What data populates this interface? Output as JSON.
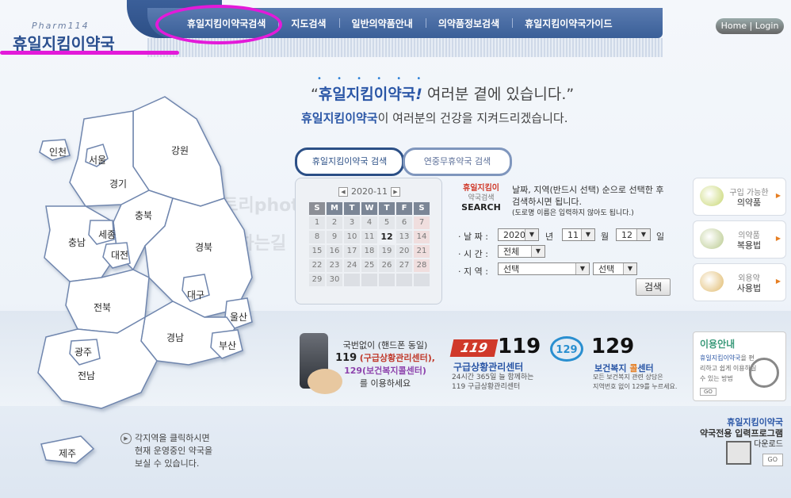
{
  "logo": {
    "sub": "Pharm114",
    "main": "휴일지킴이약국"
  },
  "nav": [
    "휴일지킴이약국검색",
    "지도검색",
    "일반의약품안내",
    "의약품정보검색",
    "휴일지킴이약국가이드"
  ],
  "home_login": "Home | Login",
  "headline": {
    "brand": "휴일지킴이약국",
    "mark": "!",
    "rest": " 여러분 곁에 있습니다.",
    "open_q": "“",
    "close_q": "”"
  },
  "subline": {
    "brand": "휴일지킴이약국",
    "rest": "이 여러분의 건강을 지켜드리겠습니다."
  },
  "watermark": {
    "line1": "스토리photo",
    "line2": "추월하는길"
  },
  "map": {
    "regions": [
      "인천",
      "서울",
      "경기",
      "강원",
      "충북",
      "세종",
      "대전",
      "충남",
      "경북",
      "대구",
      "전북",
      "울산",
      "경남",
      "부산",
      "광주",
      "전남",
      "제주"
    ],
    "hint": [
      "각지역을 클릭하시면",
      "현재 운영중인 약국을",
      "보실 수 있습니다."
    ]
  },
  "tabs": {
    "active": "휴일지킴이약국 검색",
    "inactive": "연중무휴약국 검색"
  },
  "calendar": {
    "month": "2020-11",
    "days": [
      "S",
      "M",
      "T",
      "W",
      "T",
      "F",
      "S"
    ],
    "weeks": [
      [
        "1",
        "2",
        "3",
        "4",
        "5",
        "6",
        "7"
      ],
      [
        "8",
        "9",
        "10",
        "11",
        "12",
        "13",
        "14"
      ],
      [
        "15",
        "16",
        "17",
        "18",
        "19",
        "20",
        "21"
      ],
      [
        "22",
        "23",
        "24",
        "25",
        "26",
        "27",
        "28"
      ],
      [
        "29",
        "30",
        "",
        "",
        "",
        "",
        ""
      ]
    ],
    "today": "12"
  },
  "search": {
    "title_a": "휴일지킴이",
    "title_b": "약국검색",
    "title_c": "SEARCH",
    "desc": "날짜, 지역(반드시 선택) 순으로 선택한 후 검색하시면 됩니다.",
    "desc_small": "(도로명 이름은 입력하지 않아도 됩니다.)",
    "date_label": "· 날 짜 :",
    "time_label": "· 시 간 :",
    "region_label": "· 지 역 :",
    "year": "2020",
    "year_unit": "년",
    "month": "11",
    "month_unit": "월",
    "day": "12",
    "day_unit": "일",
    "time": "전체",
    "region": "선택",
    "subregion": "선택",
    "button": "검색"
  },
  "side_cards": [
    {
      "t1": "구입 가능한",
      "t2": "의약품"
    },
    {
      "t1": "의약품",
      "t2": "복용법"
    },
    {
      "t1": "외용약",
      "t2": "사용법"
    }
  ],
  "info": {
    "title": "이용안내",
    "desc_hl": "휴일지킴이약국",
    "desc": "을 편리하고 쉽게 이용하실 수 있는 방법",
    "go": "GO"
  },
  "download": {
    "a": "휴일지킴이약국",
    "b": "약국전용 입력프로그램",
    "c": "다운로드",
    "go": "GO"
  },
  "phone": {
    "l1": "국번없이 (핸드폰 동일)",
    "n1": "119",
    "l2": "(구급상황관리센터),",
    "n2": "129",
    "l3": "(보건복지콜센터)",
    "l4": "를 이용하세요"
  },
  "e119": {
    "logo": "119",
    "num": "119",
    "title": "구급상황관리센터",
    "d1": "24시간 365일 늘 함께하는",
    "d2": "119 구급상황관리센터"
  },
  "e129": {
    "logo": "129",
    "num": "129",
    "title_a": "보건복지 ",
    "title_o": "콜",
    "title_b": "센터",
    "d1": "모든 보건복지 관련 상담은",
    "d2": "지역번호 없이 129를 누르세요."
  }
}
